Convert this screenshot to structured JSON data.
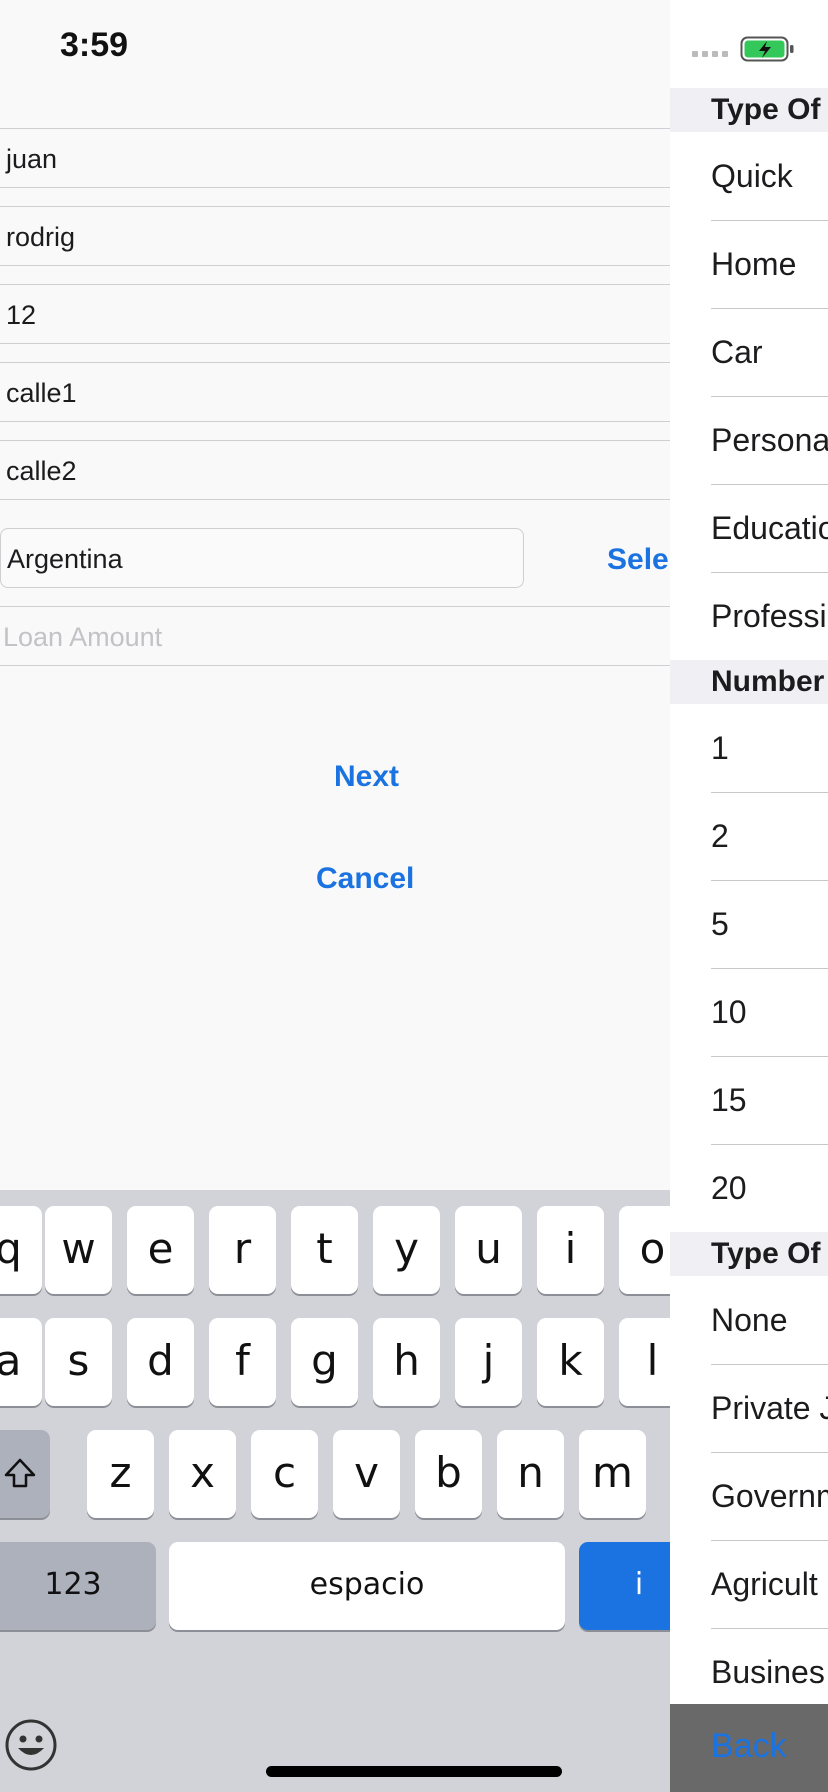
{
  "status": {
    "time": "3:59"
  },
  "form": {
    "fields": [
      "juan",
      "rodrig",
      "12",
      "calle1",
      "calle2"
    ],
    "country": "Argentina",
    "select_label": "Sele",
    "loan_placeholder": "Loan Amount",
    "next": "Next",
    "cancel": "Cancel"
  },
  "keyboard": {
    "row1": [
      "q",
      "w",
      "e",
      "r",
      "t",
      "y",
      "u",
      "i",
      "o"
    ],
    "row2": [
      "a",
      "s",
      "d",
      "f",
      "g",
      "h",
      "j",
      "k",
      "l"
    ],
    "row3": [
      "z",
      "x",
      "c",
      "v",
      "b",
      "n",
      "m"
    ],
    "numbers_key": "123",
    "space_key": "espacio",
    "return_key": "i",
    "emoji_icon": "emoji-icon",
    "shift_icon": "shift-icon"
  },
  "panel": {
    "sections": [
      {
        "title": "Type Of",
        "items": [
          "Quick",
          "Home",
          "Car",
          "Persona",
          "Educatio",
          "Professi"
        ]
      },
      {
        "title": "Number",
        "items": [
          "1",
          "2",
          "5",
          "10",
          "15",
          "20"
        ]
      },
      {
        "title": "Type Of",
        "items": [
          "None",
          "Private J",
          "Governm",
          "Agricult",
          "Busines"
        ]
      }
    ],
    "back": "Back"
  },
  "colors": {
    "accent": "#1a73e0",
    "battery": "#34c759"
  }
}
